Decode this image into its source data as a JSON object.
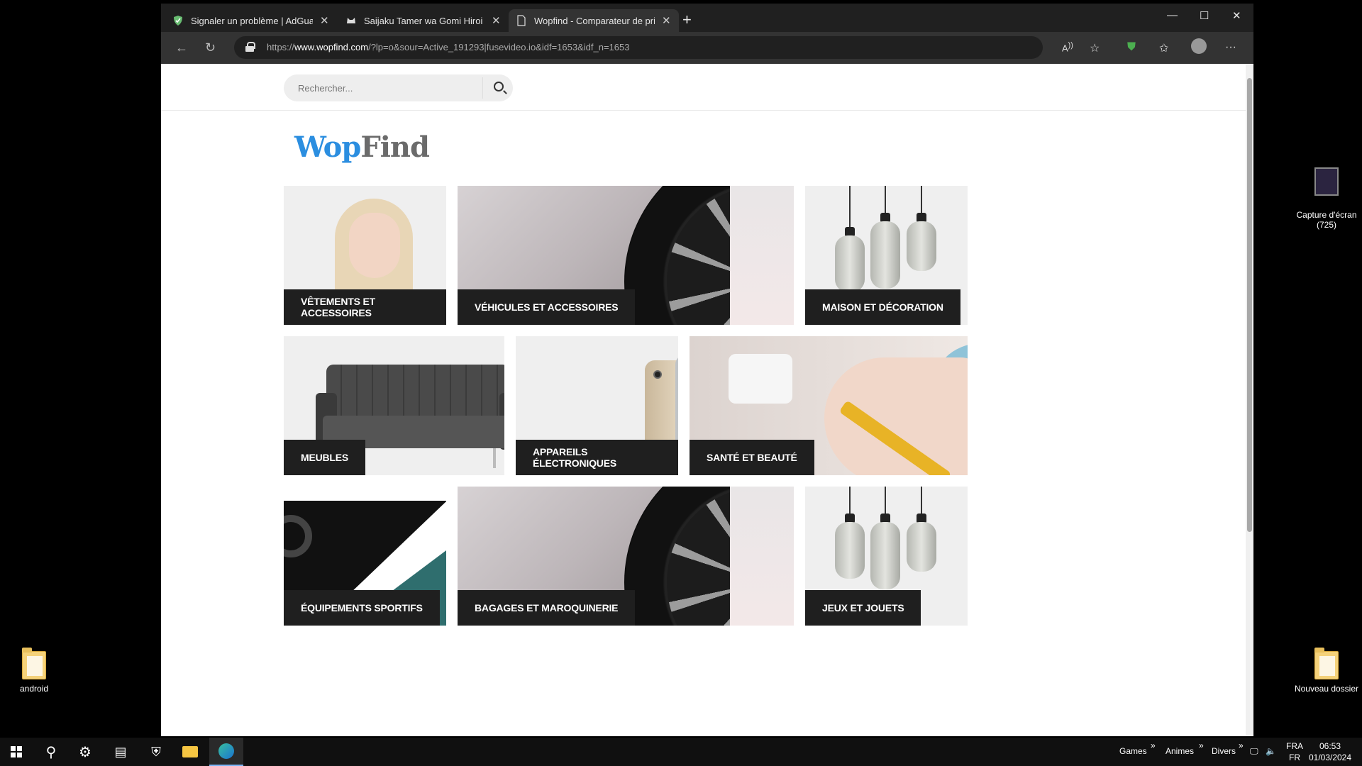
{
  "desktop": {
    "icons": [
      {
        "label": "android"
      },
      {
        "label": "Capture d'écran\n(725)"
      },
      {
        "label": "Nouveau dossier"
      }
    ]
  },
  "browser": {
    "tabs": [
      {
        "title": "Signaler un problème | AdGuard",
        "icon": "adguard-shield-icon"
      },
      {
        "title": "Saijaku Tamer wa Gomi Hiroi no",
        "icon": "cat-icon"
      },
      {
        "title": "Wopfind - Comparateur de prix p",
        "icon": "page-icon",
        "active": true
      }
    ],
    "new_tab": "+",
    "url_prefix": "https://",
    "url_domain": "www.wopfind.com",
    "url_rest": "/?lp=o&sour=Active_191293|fusevideo.io&idf=1653&idf_n=1653"
  },
  "page": {
    "search_placeholder": "Rechercher...",
    "logo_part1": "Wop",
    "logo_part2": "Find",
    "categories": [
      {
        "label": "VÊTEMENTS ET ACCESSOIRES"
      },
      {
        "label": "VÉHICULES ET ACCESSOIRES"
      },
      {
        "label": "MAISON ET DÉCORATION"
      },
      {
        "label": "MEUBLES"
      },
      {
        "label": "APPAREILS ÉLECTRONIQUES"
      },
      {
        "label": "SANTÉ ET BEAUTÉ"
      },
      {
        "label": "ÉQUIPEMENTS SPORTIFS"
      },
      {
        "label": "BAGAGES ET MAROQUINERIE"
      },
      {
        "label": "JEUX ET JOUETS"
      }
    ],
    "colors": {
      "logo_blue": "#2b8ee0",
      "logo_grey": "#6b6b6b",
      "label_bg": "#1f1f1f"
    }
  },
  "taskbar": {
    "toolbars": [
      "Games",
      "Animes",
      "Divers"
    ],
    "lang_top": "FRA",
    "lang_bottom": "FR",
    "time": "06:53",
    "date": "01/03/2024"
  }
}
